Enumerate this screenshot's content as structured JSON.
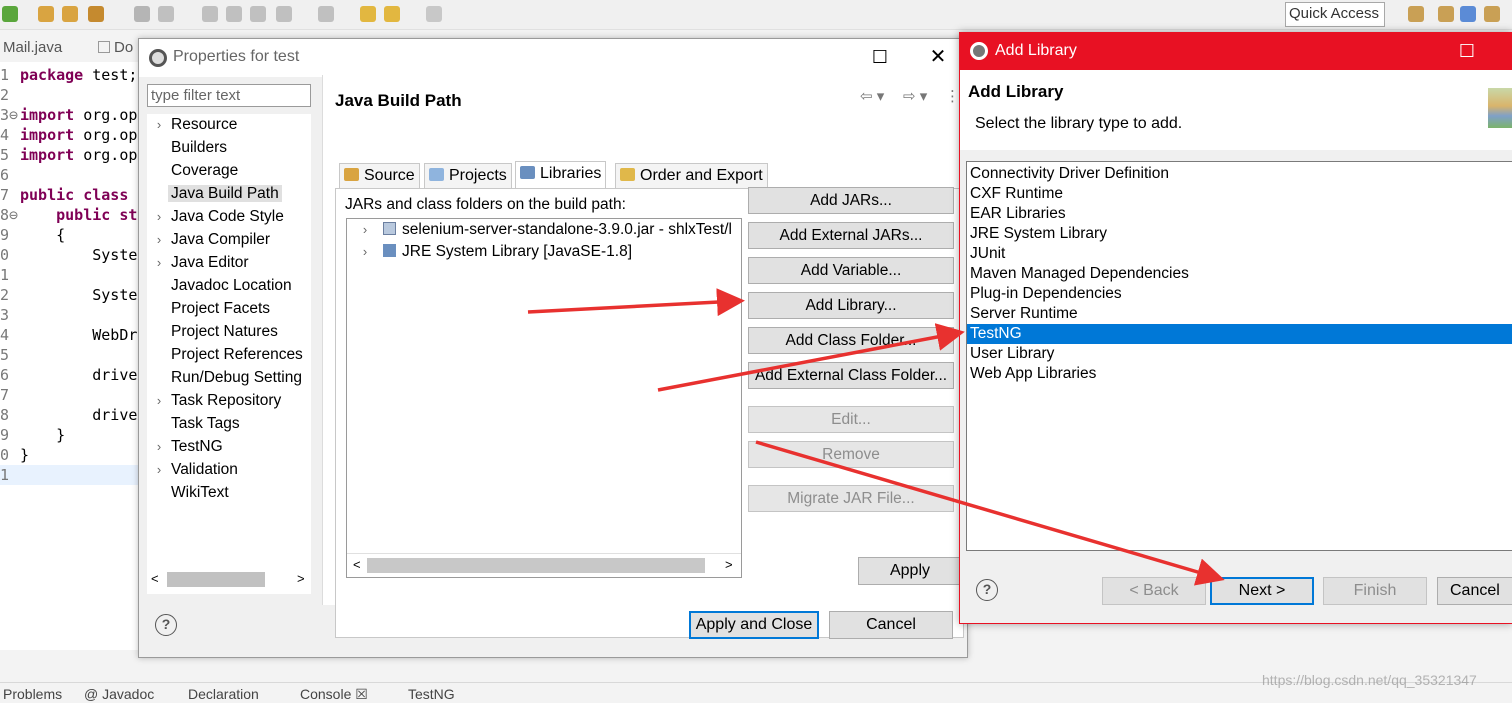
{
  "ide": {
    "quick_access": "Quick Access",
    "editor_tabs": [
      "Mail.java",
      "Do"
    ],
    "code_lines": [
      {
        "num": "1",
        "kw": "package",
        "rest": " test;"
      },
      {
        "num": "2",
        "kw": "",
        "rest": ""
      },
      {
        "num": "3⊖",
        "kw": "import",
        "rest": " org.op"
      },
      {
        "num": "4",
        "kw": "import",
        "rest": " org.op"
      },
      {
        "num": "5",
        "kw": "import",
        "rest": " org.op"
      },
      {
        "num": "6",
        "kw": "",
        "rest": ""
      },
      {
        "num": "7",
        "kw": "public class",
        "rest": ""
      },
      {
        "num": "8⊖",
        "kw": "    public st",
        "rest": ""
      },
      {
        "num": "9",
        "kw": "",
        "rest": "    {"
      },
      {
        "num": "0",
        "kw": "",
        "rest": "        Syste"
      },
      {
        "num": "1",
        "kw": "",
        "rest": ""
      },
      {
        "num": "2",
        "kw": "",
        "rest": "        Syste"
      },
      {
        "num": "3",
        "kw": "",
        "rest": ""
      },
      {
        "num": "4",
        "kw": "",
        "rest": "        WebDr"
      },
      {
        "num": "5",
        "kw": "",
        "rest": ""
      },
      {
        "num": "6",
        "kw": "",
        "rest": "        drive"
      },
      {
        "num": "7",
        "kw": "",
        "rest": ""
      },
      {
        "num": "8",
        "kw": "",
        "rest": "        drive"
      },
      {
        "num": "9",
        "kw": "",
        "rest": "    }"
      },
      {
        "num": "0",
        "kw": "",
        "rest": "}"
      },
      {
        "num": "1",
        "kw": "",
        "rest": ""
      }
    ],
    "bottom_tabs": [
      "Problems",
      "@ Javadoc",
      "Declaration",
      "Console ☒",
      "TestNG"
    ]
  },
  "properties": {
    "title": "Properties for test",
    "filter_placeholder": "type filter text",
    "tree": [
      {
        "label": "Resource",
        "expandable": true
      },
      {
        "label": "Builders",
        "expandable": false
      },
      {
        "label": "Coverage",
        "expandable": false
      },
      {
        "label": "Java Build Path",
        "expandable": false,
        "selected": true
      },
      {
        "label": "Java Code Style",
        "expandable": true
      },
      {
        "label": "Java Compiler",
        "expandable": true
      },
      {
        "label": "Java Editor",
        "expandable": true
      },
      {
        "label": "Javadoc Location",
        "expandable": false
      },
      {
        "label": "Project Facets",
        "expandable": false
      },
      {
        "label": "Project Natures",
        "expandable": false
      },
      {
        "label": "Project References",
        "expandable": false
      },
      {
        "label": "Run/Debug Setting",
        "expandable": false
      },
      {
        "label": "Task Repository",
        "expandable": true
      },
      {
        "label": "Task Tags",
        "expandable": false
      },
      {
        "label": "TestNG",
        "expandable": true
      },
      {
        "label": "Validation",
        "expandable": true
      },
      {
        "label": "WikiText",
        "expandable": false
      }
    ],
    "pane_title": "Java Build Path",
    "tabs": [
      "Source",
      "Projects",
      "Libraries",
      "Order and Export"
    ],
    "jars_label": "JARs and class folders on the build path:",
    "jars": [
      "selenium-server-standalone-3.9.0.jar - shlxTest/l",
      "JRE System Library [JavaSE-1.8]"
    ],
    "side_buttons": [
      {
        "label": "Add JARs...",
        "enabled": true
      },
      {
        "label": "Add External JARs...",
        "enabled": true
      },
      {
        "label": "Add Variable...",
        "enabled": true
      },
      {
        "label": "Add Library...",
        "enabled": true
      },
      {
        "label": "Add Class Folder...",
        "enabled": true
      },
      {
        "label": "Add External Class Folder...",
        "enabled": true
      },
      {
        "label": "Edit...",
        "enabled": false
      },
      {
        "label": "Remove",
        "enabled": false
      },
      {
        "label": "Migrate JAR File...",
        "enabled": false
      }
    ],
    "apply_label": "Apply",
    "apply_close_label": "Apply and Close",
    "cancel_label": "Cancel"
  },
  "add_library": {
    "title": "Add Library",
    "header_title": "Add Library",
    "subtitle": "Select the library type to add.",
    "libraries": [
      "Connectivity Driver Definition",
      "CXF Runtime",
      "EAR Libraries",
      "JRE System Library",
      "JUnit",
      "Maven Managed Dependencies",
      "Plug-in Dependencies",
      "Server Runtime",
      "TestNG",
      "User Library",
      "Web App Libraries"
    ],
    "selected_library": "TestNG",
    "back_label": "< Back",
    "next_label": "Next >",
    "finish_label": "Finish",
    "cancel_label": "Cancel"
  },
  "colors": {
    "addlib_titlebar": "#e81123",
    "selection": "#0078d7",
    "annotation_arrow": "#e8312f"
  },
  "watermark": "https://blog.csdn.net/qq_35321347"
}
